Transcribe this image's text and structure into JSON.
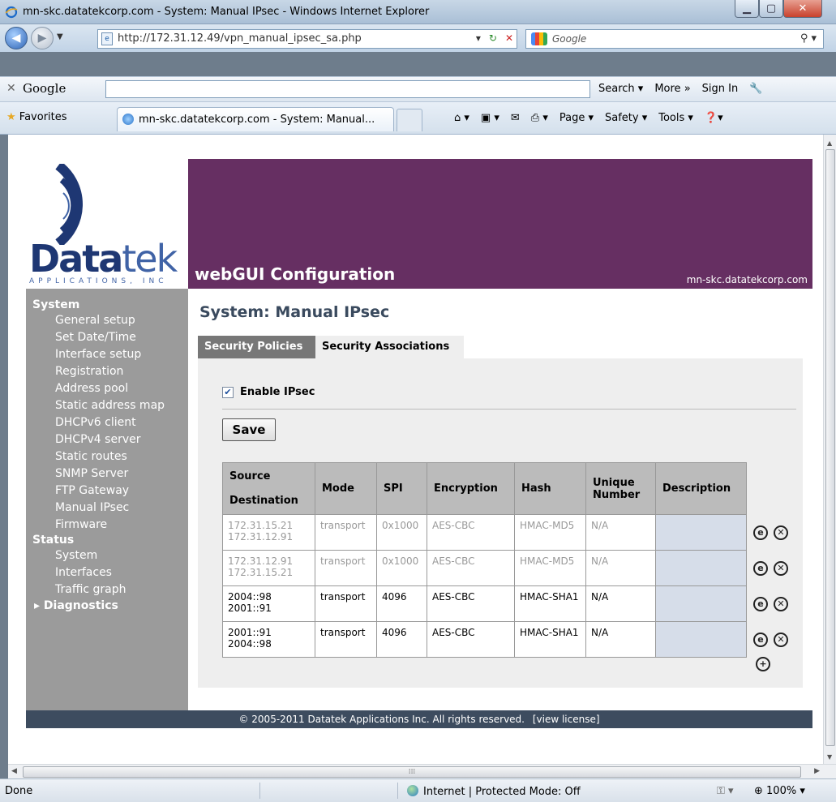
{
  "window": {
    "title": "mn-skc.datatekcorp.com - System: Manual IPsec - Windows Internet Explorer"
  },
  "navbar": {
    "url": "http://172.31.12.49/vpn_manual_ipsec_sa.php",
    "search_placeholder": "Google"
  },
  "google_toolbar": {
    "logo": "Google",
    "search_label": "Search ▾",
    "more_label": "More »",
    "signin_label": "Sign In"
  },
  "favorites_bar": {
    "favorites_label": "Favorites",
    "tab_title": "mn-skc.datatekcorp.com - System: Manual...",
    "commands": [
      "Page ▾",
      "Safety ▾",
      "Tools ▾"
    ]
  },
  "banner": {
    "title": "webGUI Configuration",
    "hostname": "mn-skc.datatekcorp.com"
  },
  "logo": {
    "word_bold": "Data",
    "word_thin": "tek",
    "subtitle": "APPLICATIONS, INC"
  },
  "sidebar": {
    "system_heading": "System",
    "system_items": [
      "General setup",
      "Set Date/Time",
      "Interface setup",
      "Registration",
      "Address pool",
      "Static address map",
      "DHCPv6 client",
      "DHCPv4 server",
      "Static routes",
      "SNMP Server",
      "FTP Gateway",
      "Manual IPsec",
      "Firmware"
    ],
    "status_heading": "Status",
    "status_items": [
      "System",
      "Interfaces",
      "Traffic graph"
    ],
    "diagnostics_label": "▸ Diagnostics"
  },
  "main": {
    "page_title": "System: Manual IPsec",
    "tabs": [
      {
        "label": "Security Policies",
        "active": false
      },
      {
        "label": "Security Associations",
        "active": true
      }
    ],
    "enable_label": "Enable IPsec",
    "enable_checked": true,
    "save_label": "Save",
    "table": {
      "headers": {
        "source": "Source",
        "destination": "Destination",
        "mode": "Mode",
        "spi": "SPI",
        "encryption": "Encryption",
        "hash": "Hash",
        "unique_number": "Unique Number",
        "description": "Description"
      },
      "rows": [
        {
          "source": "172.31.15.21",
          "destination": "172.31.12.91",
          "mode": "transport",
          "spi": "0x1000",
          "encryption": "AES-CBC",
          "hash": "HMAC-MD5",
          "unique": "N/A",
          "description": "",
          "disabled": true
        },
        {
          "source": "172.31.12.91",
          "destination": "172.31.15.21",
          "mode": "transport",
          "spi": "0x1000",
          "encryption": "AES-CBC",
          "hash": "HMAC-MD5",
          "unique": "N/A",
          "description": "",
          "disabled": true
        },
        {
          "source": "2004::98",
          "destination": "2001::91",
          "mode": "transport",
          "spi": "4096",
          "encryption": "AES-CBC",
          "hash": "HMAC-SHA1",
          "unique": "N/A",
          "description": "",
          "disabled": false
        },
        {
          "source": "2001::91",
          "destination": "2004::98",
          "mode": "transport",
          "spi": "4096",
          "encryption": "AES-CBC",
          "hash": "HMAC-SHA1",
          "unique": "N/A",
          "description": "",
          "disabled": false
        }
      ]
    }
  },
  "footer": {
    "copyright": "© 2005-2011 Datatek Applications Inc. All rights reserved.",
    "license_link": "[view license]"
  },
  "statusbar": {
    "status": "Done",
    "zone": "Internet | Protected Mode: Off",
    "zoom": "100%"
  }
}
